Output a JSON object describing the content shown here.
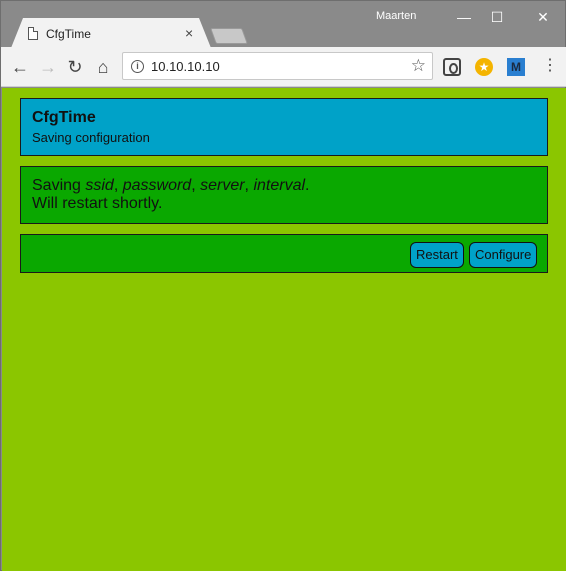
{
  "browser": {
    "tab_title": "CfgTime",
    "tab_close": "×",
    "profile_name": "Maarten",
    "window_controls": {
      "minimize": "—",
      "maximize": "☐",
      "close": "✕"
    },
    "url": "10.10.10.10",
    "icons": {
      "back": "←",
      "forward": "→",
      "reload": "↻",
      "home": "⌂",
      "info": "i",
      "star": "☆",
      "ext_coin": "★",
      "ext_m": "M",
      "menu": "⋮"
    }
  },
  "page": {
    "header": {
      "title": "CfgTime",
      "subtitle": "Saving configuration"
    },
    "message": {
      "prefix": "Saving ",
      "fields": [
        "ssid",
        "password",
        "server",
        "interval"
      ],
      "separator": ", ",
      "suffix": ".",
      "line2": "Will restart shortly."
    },
    "buttons": {
      "restart": "Restart",
      "configure": "Configure"
    },
    "colors": {
      "background": "#8bc600",
      "header_panel": "#00a2c8",
      "body_panel": "#0aa800",
      "button": "#00a2c8"
    }
  }
}
